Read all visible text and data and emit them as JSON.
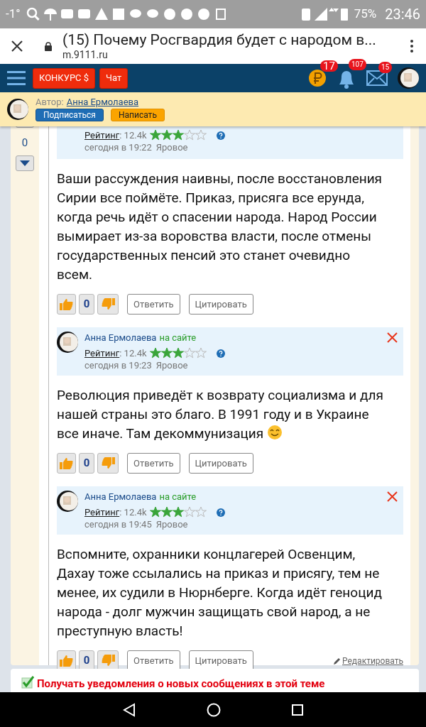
{
  "status_bar": {
    "temperature": "-1°",
    "battery": "75%",
    "time": "23:46"
  },
  "browser": {
    "title": "(15) Почему Росгвардия будет с народом в...",
    "url": "m.9111.ru"
  },
  "nav": {
    "buttons": [
      {
        "label": "КОНКУРС $"
      },
      {
        "label": "Чат"
      }
    ],
    "badges": [
      {
        "kind": "coin",
        "count": "17"
      },
      {
        "kind": "bell",
        "count": "107"
      },
      {
        "kind": "mail",
        "count": "15"
      }
    ]
  },
  "author_bar": {
    "label": "Автор:",
    "name": "Анна Ермолаева",
    "buttons": [
      {
        "label": "Подписаться",
        "kind": "primary"
      },
      {
        "label": "Написать",
        "kind": "secondary"
      }
    ]
  },
  "vote_column": {
    "count": "0"
  },
  "comments": [
    {
      "header_cut": true,
      "rating_label": "Рейтинг",
      "rating_value": ": 12.4k",
      "stars": 3,
      "date": "сегодня в 19:22",
      "place": "Яровое",
      "text": "Ваши рассуждения наивны, после восстановления Сирии все поймёте. Приказ, присяга все ерунда, когда речь идёт о спасении народа. Народ России вымирает из-за воровства власти, после отмены государственных пенсий это станет очевидно всем.",
      "emoji": false,
      "votes": "0",
      "actions": [
        "Ответить",
        "Цитировать"
      ]
    },
    {
      "header_cut": false,
      "name": "Анна Ермолаева",
      "online": "на сайте",
      "deletable": true,
      "rating_label": "Рейтинг",
      "rating_value": ": 12.4k",
      "stars": 3,
      "date": "сегодня в 19:23",
      "place": "Яровое",
      "text": "Революция приведёт к возврату социализма и для нашей страны это благо. В 1991 году и в Украине все иначе. Там декоммунизация",
      "emoji": true,
      "votes": "0",
      "actions": [
        "Ответить",
        "Цитировать"
      ]
    },
    {
      "header_cut": false,
      "name": "Анна Ермолаева",
      "online": "на сайте",
      "deletable": true,
      "rating_label": "Рейтинг",
      "rating_value": ": 12.4k",
      "stars": 3,
      "date": "сегодня в 19:45",
      "place": "Яровое",
      "text": "Вспомните, охранники концлагерей Освенцим, Дахау тоже ссылались на приказ и присягу, тем не менее, их судили в Нюрнберге. Когда идёт геноцид народа - долг мужчин защищать свой народ, а не преступную власть!",
      "emoji": false,
      "votes": "0",
      "actions": [
        "Ответить",
        "Цитировать"
      ],
      "edit_link": "Редактировать"
    }
  ],
  "notify": {
    "checked": true,
    "label": "Получать уведомления о новых сообщениях в этой теме"
  }
}
